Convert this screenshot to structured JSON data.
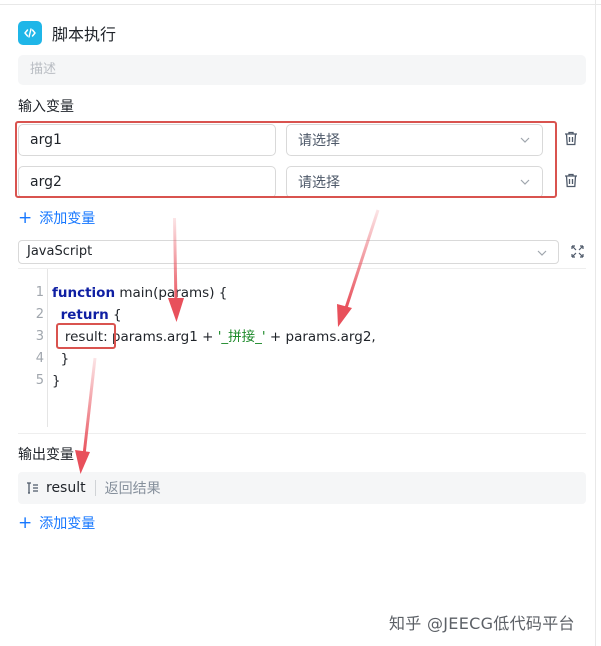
{
  "node": {
    "title": "脚本执行",
    "icon": "code-icon",
    "accent": "#1fb6e8"
  },
  "description": {
    "placeholder": "描述"
  },
  "inputs": {
    "label": "输入变量",
    "rows": [
      {
        "name": "arg1",
        "select_placeholder": "请选择"
      },
      {
        "name": "arg2",
        "select_placeholder": "请选择"
      }
    ],
    "add_label": "添加变量"
  },
  "editor": {
    "language": "JavaScript",
    "lines": [
      {
        "num": "1",
        "parts": [
          {
            "t": "function",
            "c": "kw"
          },
          {
            "t": " main(params) {",
            "c": ""
          }
        ]
      },
      {
        "num": "2",
        "parts": [
          {
            "t": "  ",
            "c": ""
          },
          {
            "t": "return",
            "c": "kw"
          },
          {
            "t": " {",
            "c": ""
          }
        ]
      },
      {
        "num": "3",
        "parts": [
          {
            "t": "   result: params.arg1 + ",
            "c": ""
          },
          {
            "t": "'_拼接_'",
            "c": "str"
          },
          {
            "t": " + params.arg2,",
            "c": ""
          }
        ]
      },
      {
        "num": "4",
        "parts": [
          {
            "t": "  }",
            "c": ""
          }
        ]
      },
      {
        "num": "5",
        "parts": [
          {
            "t": "}",
            "c": ""
          }
        ]
      }
    ]
  },
  "outputs": {
    "label": "输出变量",
    "rows": [
      {
        "name": "result",
        "description": "返回结果"
      }
    ],
    "add_label": "添加变量"
  },
  "watermark": "知乎 @JEECG低代码平台",
  "colors": {
    "link": "#1677ff",
    "annotation": "#d9534f",
    "arrow": "#e8505b"
  }
}
